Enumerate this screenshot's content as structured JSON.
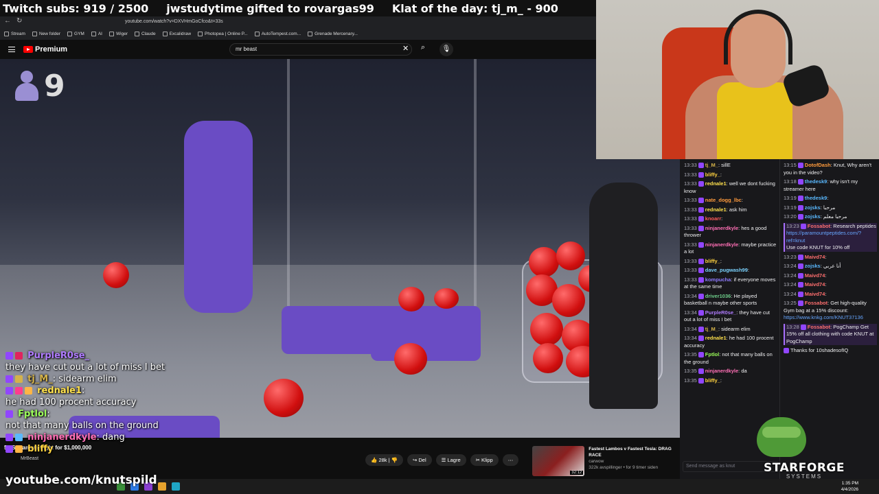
{
  "banner": {
    "subs": "Twitch subs: 919 / 2500",
    "gift": "jwstudytime gifted to rovargas99",
    "klat": "Klat of the day: tj_m_ - 900"
  },
  "browser": {
    "url": "youtube.com/watch?v=DXVHmGoCfco&t=33s",
    "bookmarks": [
      "Stream",
      "New folder",
      "GYM",
      "AI",
      "Wiger",
      "Claude",
      "Excalidraw",
      "Photopea | Online P...",
      "AutoTempest.com...",
      "Grenade Mercenary..."
    ]
  },
  "youtube": {
    "brand": "Premium",
    "search_value": "mr beast",
    "viewer_count": "9",
    "video_title": "50 Streamers Fight for $1,000,000",
    "channel": "MrBeast",
    "like_count": "28k",
    "actions": {
      "share": "Del",
      "save": "Lagre",
      "clip": "Klipp"
    },
    "recommended": {
      "title": "Fastest Lambos v Fastest Tesla: DRAG RACE",
      "channel": "carwow",
      "meta": "322k avspillinger • for 9 timer siden",
      "duration": "32:12"
    }
  },
  "overlay_chat": [
    {
      "name": "PurpleR0se_",
      "text": "",
      "color": "#b07cff"
    },
    {
      "name": "",
      "text": "they have cut out a lot of miss I bet",
      "color": "#ffffff"
    },
    {
      "name": "tj_M_",
      "text": ": sidearm elim",
      "color": "#d4b24a"
    },
    {
      "name": "rednale1",
      "text": ":",
      "color": "#ffe14d"
    },
    {
      "name": "",
      "text": "he had 100 procent accuracy",
      "color": "#ffffff"
    },
    {
      "name": "Fptlol",
      "text": ":",
      "color": "#9cff5a"
    },
    {
      "name": "",
      "text": "not that many balls on the ground",
      "color": "#ffffff"
    },
    {
      "name": "ninjanerdkyle",
      "text": ": dang",
      "color": "#ff6fb5"
    },
    {
      "name": "bliffy",
      "text": "",
      "color": "#ffd23f"
    }
  ],
  "handle": "youtube.com/knutspild",
  "chat_left": [
    {
      "time": "13:33",
      "user": "tj_M_",
      "color": "#d4b24a",
      "msg": "sillE"
    },
    {
      "time": "13:33",
      "user": "bliffy_",
      "color": "#ffd23f",
      "msg": ""
    },
    {
      "time": "13:33",
      "user": "rednale1",
      "color": "#ffe14d",
      "msg": "well we dont fucking know"
    },
    {
      "time": "13:33",
      "user": "nate_dogg_lbc",
      "color": "#ff9b3d",
      "msg": ""
    },
    {
      "time": "13:33",
      "user": "rednale1",
      "color": "#ffe14d",
      "msg": "ask him"
    },
    {
      "time": "13:33",
      "user": "knoarr",
      "color": "#ff5a5a",
      "msg": ""
    },
    {
      "time": "13:33",
      "user": "ninjanerdkyle",
      "color": "#ff6fb5",
      "msg": "hes a good thrower"
    },
    {
      "time": "13:33",
      "user": "ninjanerdkyle",
      "color": "#ff6fb5",
      "msg": "maybe practice a lot"
    },
    {
      "time": "13:33",
      "user": "bliffy_",
      "color": "#ffd23f",
      "msg": ""
    },
    {
      "time": "13:33",
      "user": "dave_pugwash99",
      "color": "#7bd3ff",
      "msg": ""
    },
    {
      "time": "13:33",
      "user": "kompucha",
      "color": "#8f7bff",
      "msg": "if everyone moves at the same time"
    },
    {
      "time": "13:34",
      "user": "driver1036",
      "color": "#6fd08c",
      "msg": "He played basketball n maybe other sports"
    },
    {
      "time": "13:34",
      "user": "PurpleR0se_",
      "color": "#b07cff",
      "msg": "they have cut out a lot of miss I bet"
    },
    {
      "time": "13:34",
      "user": "tj_M_",
      "color": "#d4b24a",
      "msg": "sidearm elim"
    },
    {
      "time": "13:34",
      "user": "rednale1",
      "color": "#ffe14d",
      "msg": "he had 100 procent accuracy"
    },
    {
      "time": "13:35",
      "user": "Fptlol",
      "color": "#9cff5a",
      "msg": "not that many balls on the ground"
    },
    {
      "time": "13:35",
      "user": "ninjanerdkyle",
      "color": "#ff6fb5",
      "msg": "da"
    },
    {
      "time": "13:35",
      "user": "bliffy_",
      "color": "#ffd23f",
      "msg": ""
    }
  ],
  "chat_right": [
    {
      "time": "13:15",
      "user": "DotofDash",
      "color": "#ff9b3d",
      "msg": "Knut, Why aren't you in the video?",
      "hl": false
    },
    {
      "time": "13:18",
      "user": "thedesk9",
      "color": "#5ab9ff",
      "msg": "why isn't my streamer here",
      "hl": false
    },
    {
      "time": "13:19",
      "user": "thedesk9",
      "color": "#5ab9ff",
      "msg": "",
      "hl": false
    },
    {
      "time": "13:19",
      "user": "zojsks",
      "color": "#5ab9ff",
      "msg": "مرحبا",
      "hl": false
    },
    {
      "time": "13:20",
      "user": "zojsks",
      "color": "#5ab9ff",
      "msg": "مرحبا معلم",
      "hl": false
    },
    {
      "time": "13:23",
      "user": "Fossabot",
      "color": "#ff6f6f",
      "msg": "Research peptides",
      "link": "https://paramountpeptides.com/?ref=knut",
      "tail": "Use code KNUT for 10% off",
      "hl": true
    },
    {
      "time": "13:23",
      "user": "Maivd74",
      "color": "#ff6f6f",
      "msg": "",
      "hl": false
    },
    {
      "time": "13:24",
      "user": "zojsks",
      "color": "#5ab9ff",
      "msg": "أنا عربي",
      "hl": false
    },
    {
      "time": "13:24",
      "user": "Maivd74",
      "color": "#ff6f6f",
      "msg": "",
      "hl": false
    },
    {
      "time": "13:24",
      "user": "Maivd74",
      "color": "#ff6f6f",
      "msg": "",
      "hl": false
    },
    {
      "time": "13:24",
      "user": "Maivd74",
      "color": "#ff6f6f",
      "msg": "",
      "hl": false
    },
    {
      "time": "13:25",
      "user": "Fossabot",
      "color": "#ff6f6f",
      "msg": "Get high-quality Gym bag at a 15% discount:",
      "link": "https://www.knkg.com/KNUT37136",
      "tail": "",
      "hl": false
    },
    {
      "time": "13:28",
      "user": "Fossabot",
      "color": "#ff6f6f",
      "msg": "PogChamp Get 15% off all clothing with code KNUT at PogChamp",
      "link": "",
      "tail": "",
      "hl": true
    },
    {
      "time": "",
      "user": "",
      "color": "#ff6f6f",
      "msg": "Thanks for 10shadesofIQ",
      "link": "",
      "tail": "",
      "hl": false
    }
  ],
  "chat_input_placeholder": "Send message as knut",
  "starforge": {
    "title": "STARFORGE",
    "sub": "SYSTEMS"
  },
  "clock": {
    "time": "1:35 PM",
    "date": "4/4/2026"
  }
}
